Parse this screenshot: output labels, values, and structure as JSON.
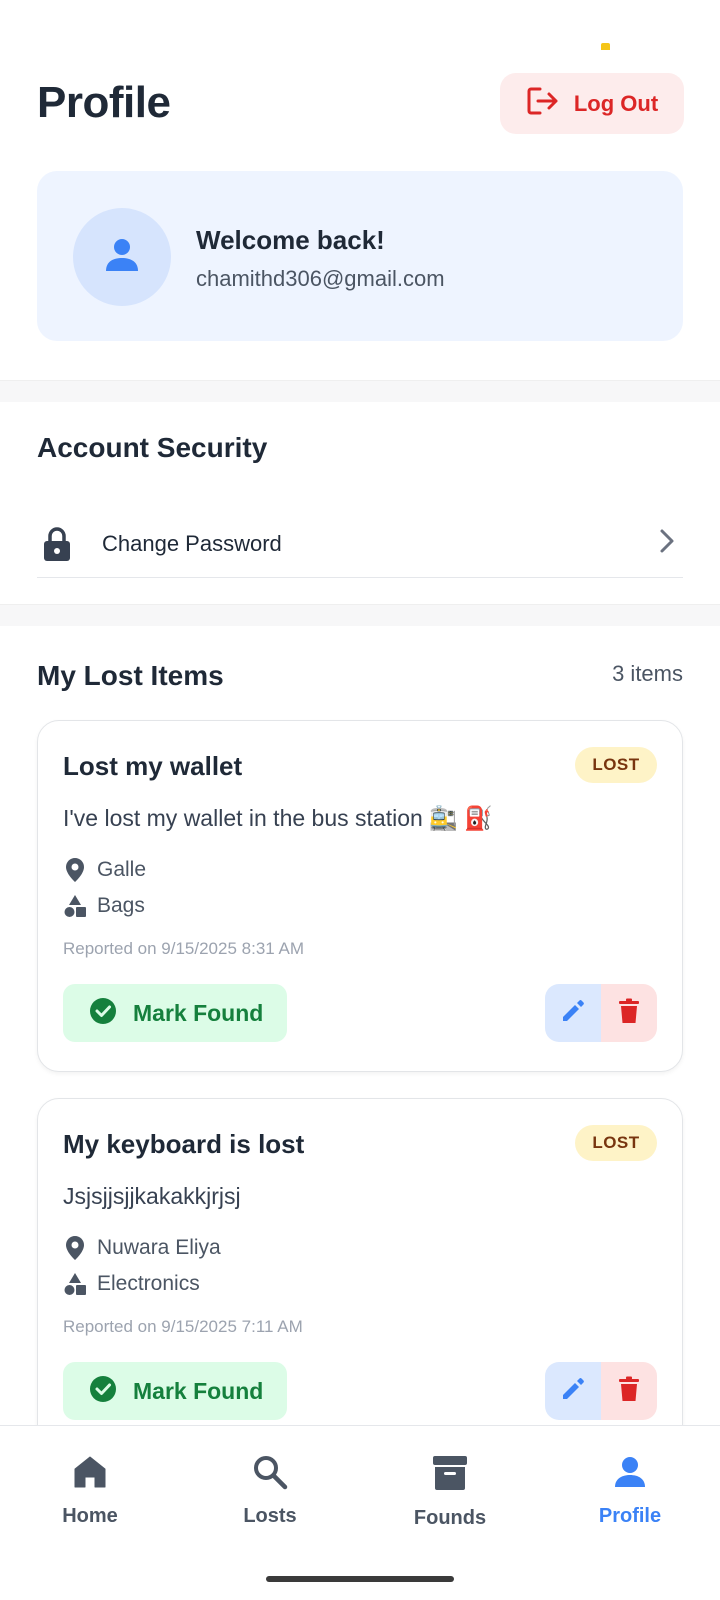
{
  "header": {
    "title": "Profile",
    "logout_label": "Log Out"
  },
  "welcome": {
    "title": "Welcome back!",
    "email": "chamithd306@gmail.com"
  },
  "security": {
    "title": "Account Security",
    "change_password_label": "Change Password"
  },
  "lost_items": {
    "title": "My Lost Items",
    "count_label": "3 items",
    "items": [
      {
        "title": "Lost my wallet",
        "badge": "LOST",
        "description": "I've lost my wallet in the bus station 🚉 ⛽",
        "location": "Galle",
        "category": "Bags",
        "reported": "Reported on 9/15/2025 8:31 AM",
        "mark_found_label": "Mark Found"
      },
      {
        "title": "My keyboard is lost",
        "badge": "LOST",
        "description": "Jsjsjjsjjkakakkjrjsj",
        "location": "Nuwara Eliya",
        "category": "Electronics",
        "reported": "Reported on 9/15/2025 7:11 AM",
        "mark_found_label": "Mark Found"
      }
    ]
  },
  "bottom_nav": {
    "items": [
      {
        "label": "Home",
        "icon": "home-icon"
      },
      {
        "label": "Losts",
        "icon": "search-icon"
      },
      {
        "label": "Founds",
        "icon": "archive-icon"
      },
      {
        "label": "Profile",
        "icon": "person-icon"
      }
    ],
    "active": "Profile"
  },
  "colors": {
    "accent": "#3b82f6",
    "danger": "#dc2626",
    "success": "#15803d",
    "badge_bg": "#fef3c7"
  }
}
